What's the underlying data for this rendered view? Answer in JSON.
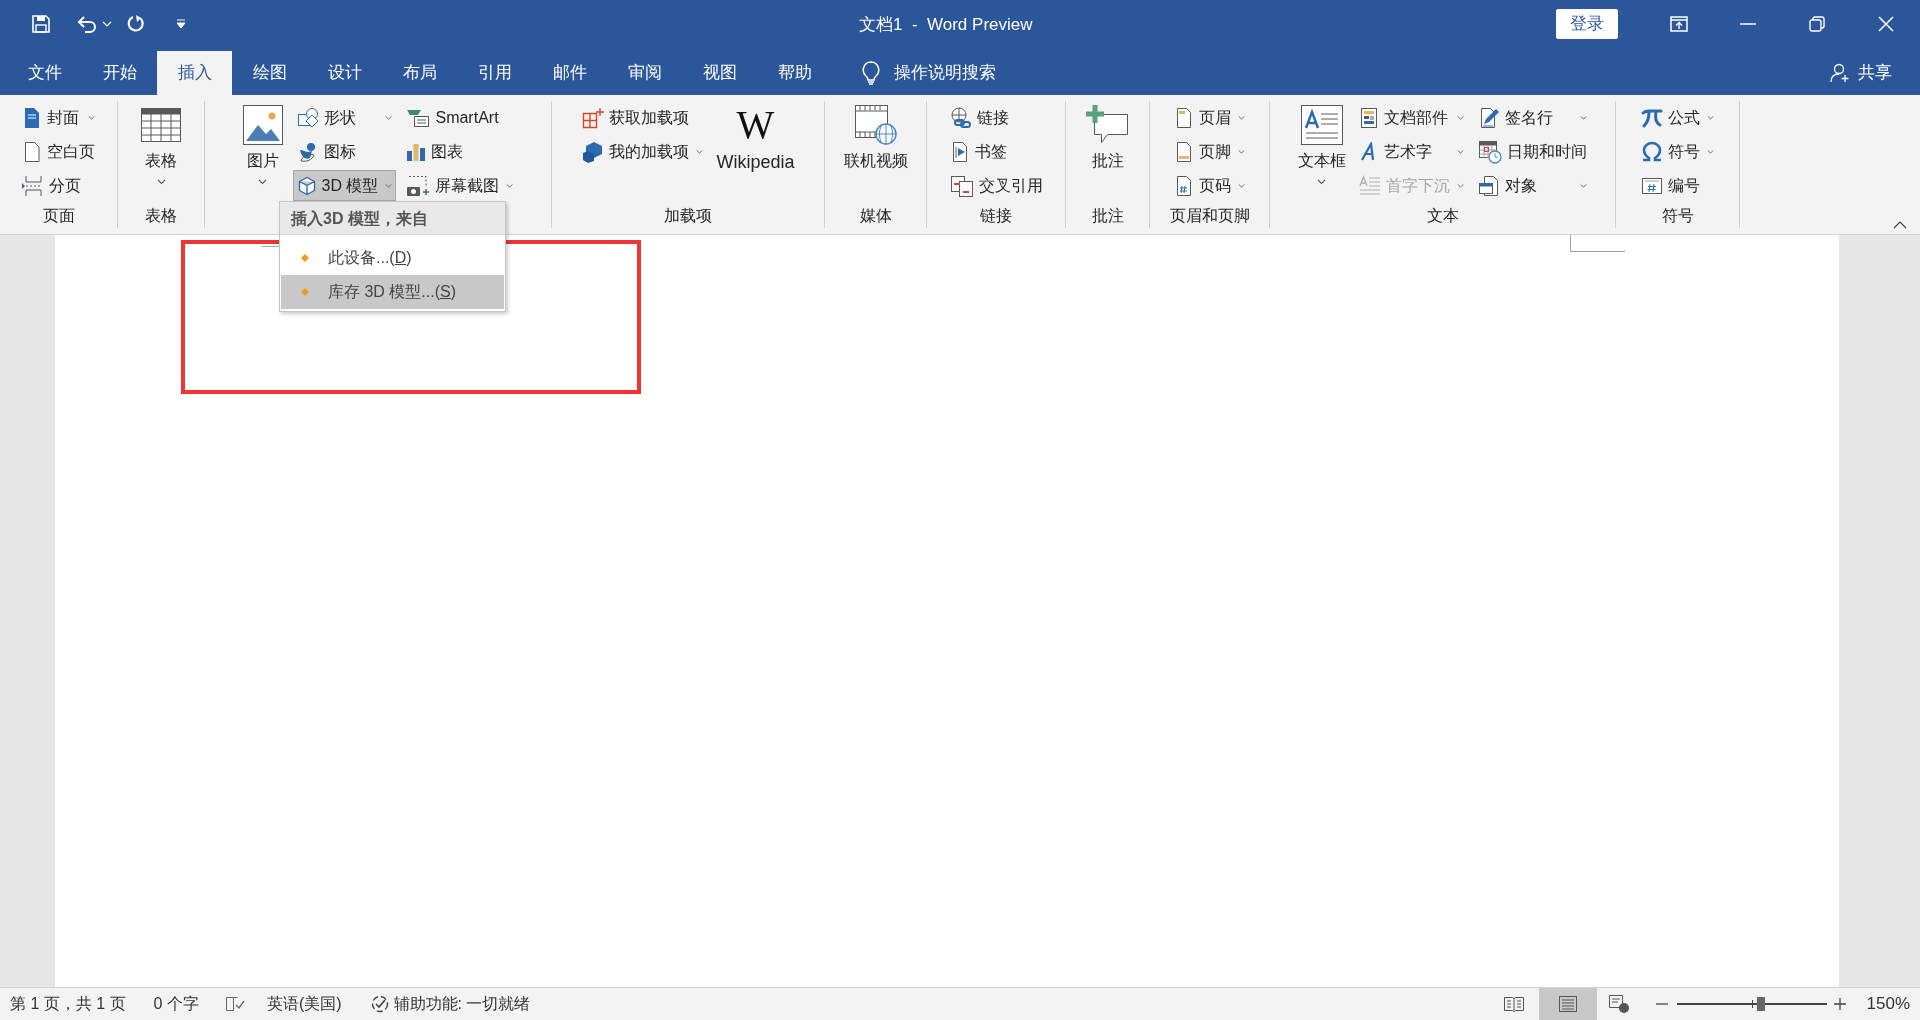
{
  "window": {
    "title": "文档1  -  Word Preview",
    "sign_in": "登录"
  },
  "tabs": [
    {
      "label": "文件",
      "selected": false
    },
    {
      "label": "开始",
      "selected": false
    },
    {
      "label": "插入",
      "selected": true
    },
    {
      "label": "绘图",
      "selected": false
    },
    {
      "label": "设计",
      "selected": false
    },
    {
      "label": "布局",
      "selected": false
    },
    {
      "label": "引用",
      "selected": false
    },
    {
      "label": "邮件",
      "selected": false
    },
    {
      "label": "审阅",
      "selected": false
    },
    {
      "label": "视图",
      "selected": false
    },
    {
      "label": "帮助",
      "selected": false
    }
  ],
  "tell_me": "操作说明搜索",
  "share": "共享",
  "ribbon": {
    "groups": [
      {
        "label": "页面",
        "columns": [
          {
            "kind": "stack",
            "items": [
              {
                "label": "封面",
                "dropdown": true,
                "expanded": false,
                "disabled": false
              },
              {
                "label": "空白页",
                "dropdown": false,
                "expanded": false,
                "disabled": false
              },
              {
                "label": "分页",
                "dropdown": false,
                "expanded": false,
                "disabled": false
              }
            ]
          }
        ]
      },
      {
        "label": "表格",
        "columns": [
          {
            "kind": "large",
            "label": "表格",
            "dropdown": true
          }
        ]
      },
      {
        "columns": [
          {
            "kind": "large",
            "label": "图片",
            "dropdown": true
          },
          {
            "kind": "stack",
            "items": [
              {
                "label": "形状",
                "dropdown": true,
                "expanded": false,
                "disabled": false
              },
              {
                "label": "图标",
                "dropdown": false,
                "expanded": false,
                "disabled": false
              },
              {
                "label": "3D 模型",
                "dropdown": true,
                "expanded": true,
                "disabled": false
              }
            ]
          },
          {
            "kind": "stack",
            "items": [
              {
                "label": "SmartArt",
                "dropdown": false,
                "expanded": false,
                "disabled": false
              },
              {
                "label": "图表",
                "dropdown": false,
                "expanded": false,
                "disabled": false
              },
              {
                "label": "屏幕截图",
                "dropdown": true,
                "expanded": false,
                "disabled": false
              }
            ]
          }
        ]
      },
      {
        "label": "加载项",
        "columns": [
          {
            "kind": "stack",
            "items": [
              {
                "label": "获取加载项",
                "dropdown": false,
                "expanded": false,
                "disabled": false
              },
              {
                "label": "我的加载项",
                "dropdown": true,
                "expanded": false,
                "disabled": false
              }
            ]
          },
          {
            "kind": "large",
            "label": "Wikipedia",
            "logo": "W",
            "dropdown": false
          }
        ]
      },
      {
        "label": "媒体",
        "columns": [
          {
            "kind": "large",
            "label": "联机视频",
            "dropdown": false
          }
        ]
      },
      {
        "label": "链接",
        "columns": [
          {
            "kind": "stack",
            "items": [
              {
                "label": "链接",
                "dropdown": false,
                "expanded": false,
                "disabled": false
              },
              {
                "label": "书签",
                "dropdown": false,
                "expanded": false,
                "disabled": false
              },
              {
                "label": "交叉引用",
                "dropdown": false,
                "expanded": false,
                "disabled": false
              }
            ]
          }
        ]
      },
      {
        "label": "批注",
        "columns": [
          {
            "kind": "large",
            "label": "批注",
            "dropdown": false
          }
        ]
      },
      {
        "label": "页眉和页脚",
        "columns": [
          {
            "kind": "stack",
            "items": [
              {
                "label": "页眉",
                "dropdown": true,
                "expanded": false,
                "disabled": false
              },
              {
                "label": "页脚",
                "dropdown": true,
                "expanded": false,
                "disabled": false
              },
              {
                "label": "页码",
                "dropdown": true,
                "expanded": false,
                "disabled": false
              }
            ]
          }
        ]
      },
      {
        "label": "文本",
        "columns": [
          {
            "kind": "large",
            "label": "文本框",
            "dropdown": true
          },
          {
            "kind": "stack",
            "items": [
              {
                "label": "文档部件",
                "dropdown": true,
                "expanded": false,
                "disabled": false
              },
              {
                "label": "艺术字",
                "dropdown": true,
                "expanded": false,
                "disabled": false
              },
              {
                "label": "首字下沉",
                "dropdown": true,
                "expanded": false,
                "disabled": true
              }
            ]
          },
          {
            "kind": "stack",
            "items": [
              {
                "label": "签名行",
                "dropdown": true,
                "expanded": false,
                "disabled": false
              },
              {
                "label": "日期和时间",
                "dropdown": false,
                "expanded": false,
                "disabled": false
              },
              {
                "label": "对象",
                "dropdown": true,
                "expanded": false,
                "disabled": false
              }
            ]
          }
        ]
      },
      {
        "label": "符号",
        "columns": [
          {
            "kind": "stack",
            "items": [
              {
                "label": "公式",
                "dropdown": true,
                "expanded": false,
                "disabled": false
              },
              {
                "label": "符号",
                "dropdown": true,
                "expanded": false,
                "disabled": false
              },
              {
                "label": "编号",
                "dropdown": false,
                "expanded": false,
                "disabled": false
              }
            ]
          }
        ]
      }
    ]
  },
  "menu": {
    "header": "插入3D 模型，来自",
    "items": [
      {
        "label": "此设备...(",
        "accesskey": "D",
        "after": ")",
        "selected": false
      },
      {
        "label": "库存 3D 模型...(",
        "accesskey": "S",
        "after": ")",
        "selected": true
      }
    ]
  },
  "status_bar": {
    "items": [
      "第 1 页，共 1 页",
      "0 个字",
      "英语(美国)",
      "辅助功能: 一切就绪"
    ],
    "views": [
      {
        "selected": false
      },
      {
        "selected": true
      },
      {
        "selected": false
      }
    ],
    "zoom": {
      "level": 0.56,
      "reading": "150%"
    }
  }
}
